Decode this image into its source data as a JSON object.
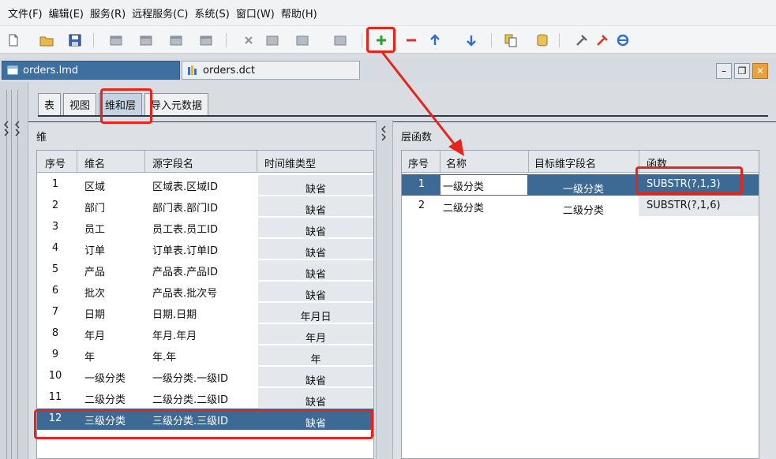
{
  "menu": [
    {
      "label": "文件(F)"
    },
    {
      "label": "编辑(E)"
    },
    {
      "label": "服务(R)"
    },
    {
      "label": "远程服务(C)"
    },
    {
      "label": "系统(S)"
    },
    {
      "label": "窗口(W)"
    },
    {
      "label": "帮助(H)"
    }
  ],
  "toolbar": {
    "icons": [
      "new-icon",
      "open-icon",
      "save-icon",
      "table-icon",
      "table-link-icon",
      "table-edit-icon",
      "table-field-icon",
      "delete-x-icon",
      "copy-table-icon",
      "table-add-icon",
      "table-remove-icon",
      "add-icon",
      "remove-icon",
      "move-up-icon",
      "move-down-icon",
      "copy-icon",
      "database-icon",
      "tool-icon",
      "tool2-icon",
      "browser-icon"
    ]
  },
  "doc_tabs": [
    {
      "label": "orders.lmd",
      "active": true
    },
    {
      "label": "orders.dct",
      "active": false
    }
  ],
  "sub_tabs": [
    {
      "label": "表"
    },
    {
      "label": "视图"
    },
    {
      "label": "维和层"
    },
    {
      "label": "导入元数据"
    }
  ],
  "dimensions": {
    "title": "维",
    "columns": [
      "序号",
      "维名",
      "源字段名",
      "时间维类型"
    ],
    "rows": [
      {
        "no": "1",
        "name": "区域",
        "source": "区域表.区域ID",
        "time_type": "缺省"
      },
      {
        "no": "2",
        "name": "部门",
        "source": "部门表.部门ID",
        "time_type": "缺省"
      },
      {
        "no": "3",
        "name": "员工",
        "source": "员工表.员工ID",
        "time_type": "缺省"
      },
      {
        "no": "4",
        "name": "订单",
        "source": "订单表.订单ID",
        "time_type": "缺省"
      },
      {
        "no": "5",
        "name": "产品",
        "source": "产品表.产品ID",
        "time_type": "缺省"
      },
      {
        "no": "6",
        "name": "批次",
        "source": "产品表.批次号",
        "time_type": "缺省"
      },
      {
        "no": "7",
        "name": "日期",
        "source": "日期.日期",
        "time_type": "年月日"
      },
      {
        "no": "8",
        "name": "年月",
        "source": "年月.年月",
        "time_type": "年月"
      },
      {
        "no": "9",
        "name": "年",
        "source": "年.年",
        "time_type": "年"
      },
      {
        "no": "10",
        "name": "一级分类",
        "source": "一级分类.一级ID",
        "time_type": "缺省"
      },
      {
        "no": "11",
        "name": "二级分类",
        "source": "二级分类.二级ID",
        "time_type": "缺省"
      },
      {
        "no": "12",
        "name": "三级分类",
        "source": "三级分类.三级ID",
        "time_type": "缺省"
      }
    ]
  },
  "levels": {
    "title": "层函数",
    "columns": [
      "序号",
      "名称",
      "目标维字段名",
      "函数"
    ],
    "rows": [
      {
        "no": "1",
        "name": "一级分类",
        "target": "一级分类",
        "func": "SUBSTR(?,1,3)"
      },
      {
        "no": "2",
        "name": "二级分类",
        "target": "二级分类",
        "func": "SUBSTR(?,1,6)"
      }
    ]
  },
  "colors": {
    "selection": "#3d6a95",
    "highlight": "#e5251c",
    "add_button": "#2e9e2e",
    "remove_button": "#d9342b",
    "arrow_buttons": "#2f6fd0"
  }
}
